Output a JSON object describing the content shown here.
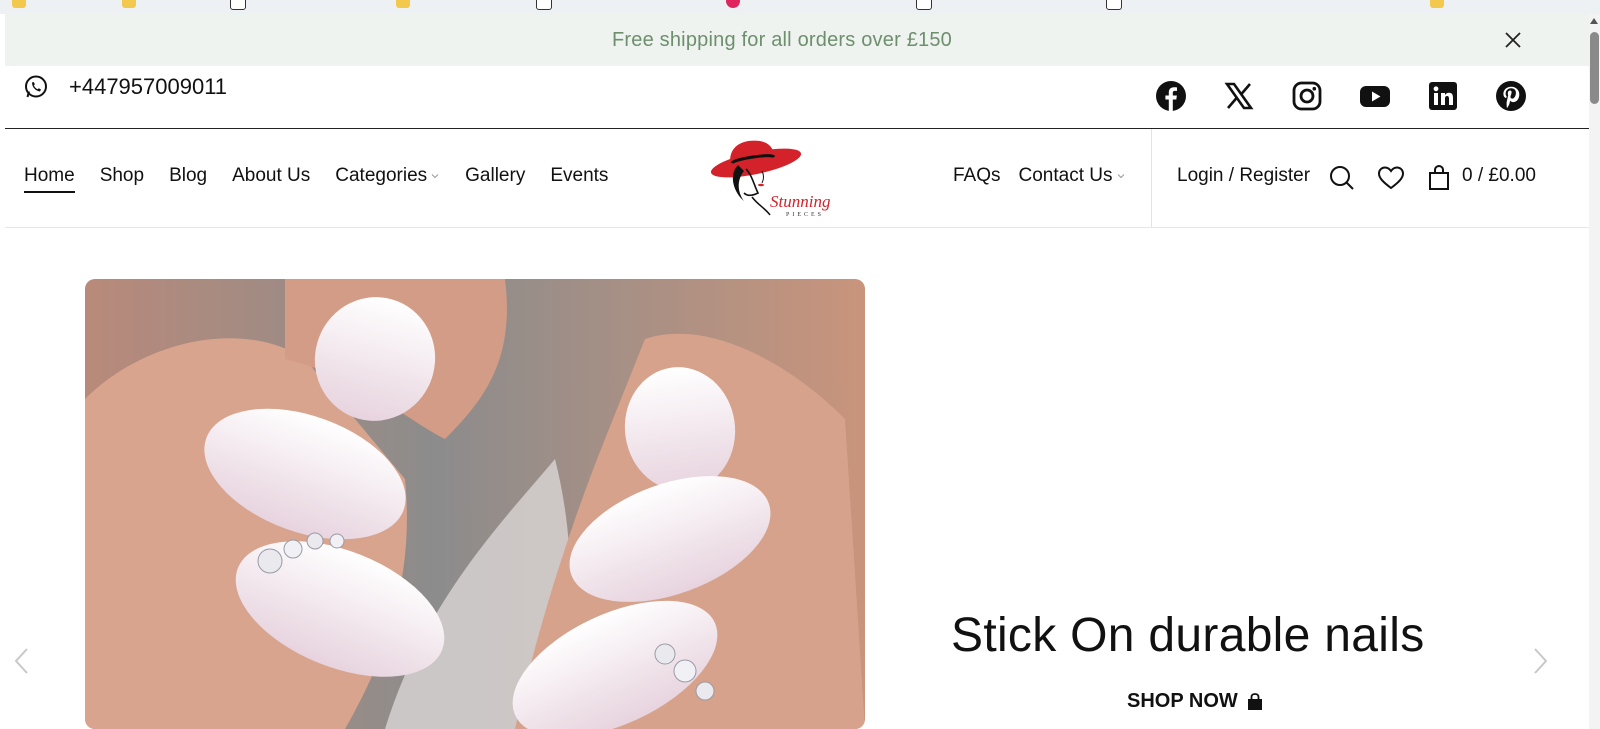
{
  "announcement": {
    "text": "Free shipping for all orders over £150"
  },
  "contact": {
    "phone": "+447957009011"
  },
  "socials": [
    "facebook-icon",
    "x-icon",
    "instagram-icon",
    "youtube-icon",
    "linkedin-icon",
    "pinterest-icon"
  ],
  "nav": {
    "left": [
      {
        "label": "Home",
        "active": true
      },
      {
        "label": "Shop"
      },
      {
        "label": "Blog"
      },
      {
        "label": "About Us"
      },
      {
        "label": "Categories",
        "dropdown": true
      },
      {
        "label": "Gallery"
      },
      {
        "label": "Events"
      }
    ],
    "right": [
      {
        "label": "FAQs"
      },
      {
        "label": "Contact Us",
        "dropdown": true
      }
    ],
    "account": "Login / Register",
    "cart_total": "0 / £0.00"
  },
  "logo": {
    "text": "Stunning",
    "subtext": "PIECES"
  },
  "hero": {
    "title": "Stick On durable nails",
    "cta": "SHOP NOW"
  },
  "colors": {
    "announcement_bg": "#eef3ef",
    "announcement_text": "#6e8f6e",
    "logo_red": "#d4222a"
  }
}
